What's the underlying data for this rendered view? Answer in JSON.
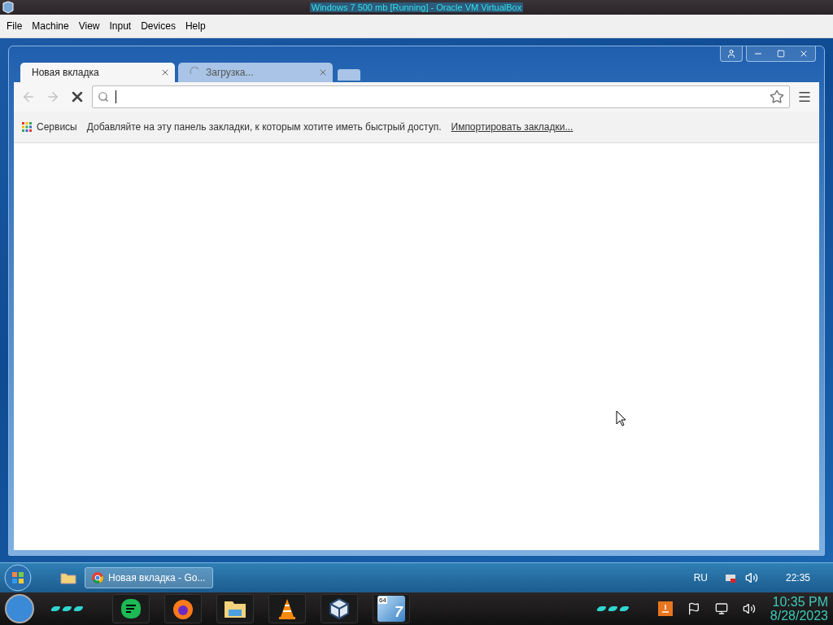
{
  "host_window": {
    "title": "Windows 7 500 mb [Running] - Oracle VM VirtualBox"
  },
  "menu": [
    "File",
    "Machine",
    "View",
    "Input",
    "Devices",
    "Help"
  ],
  "browser": {
    "tabs": [
      {
        "label": "Новая вкладка",
        "selected": true,
        "loading": false
      },
      {
        "label": "Загрузка...",
        "selected": false,
        "loading": true
      }
    ],
    "nav": {
      "back_disabled": true,
      "forward_disabled": true
    },
    "bookmarks_bar": {
      "apps": "Сервисы",
      "message": "Добавляйте на эту панель закладки, к которым хотите иметь быстрый доступ.",
      "import_link": "Импортировать закладки..."
    }
  },
  "guest_taskbar": {
    "tasks": [
      {
        "label": "Новая вкладка - Go...",
        "selected": true
      }
    ],
    "language": "RU",
    "time": "22:35"
  },
  "host_dock": {
    "badge": "64",
    "version": "7",
    "time": "10:35 PM",
    "date": "8/28/2023"
  }
}
